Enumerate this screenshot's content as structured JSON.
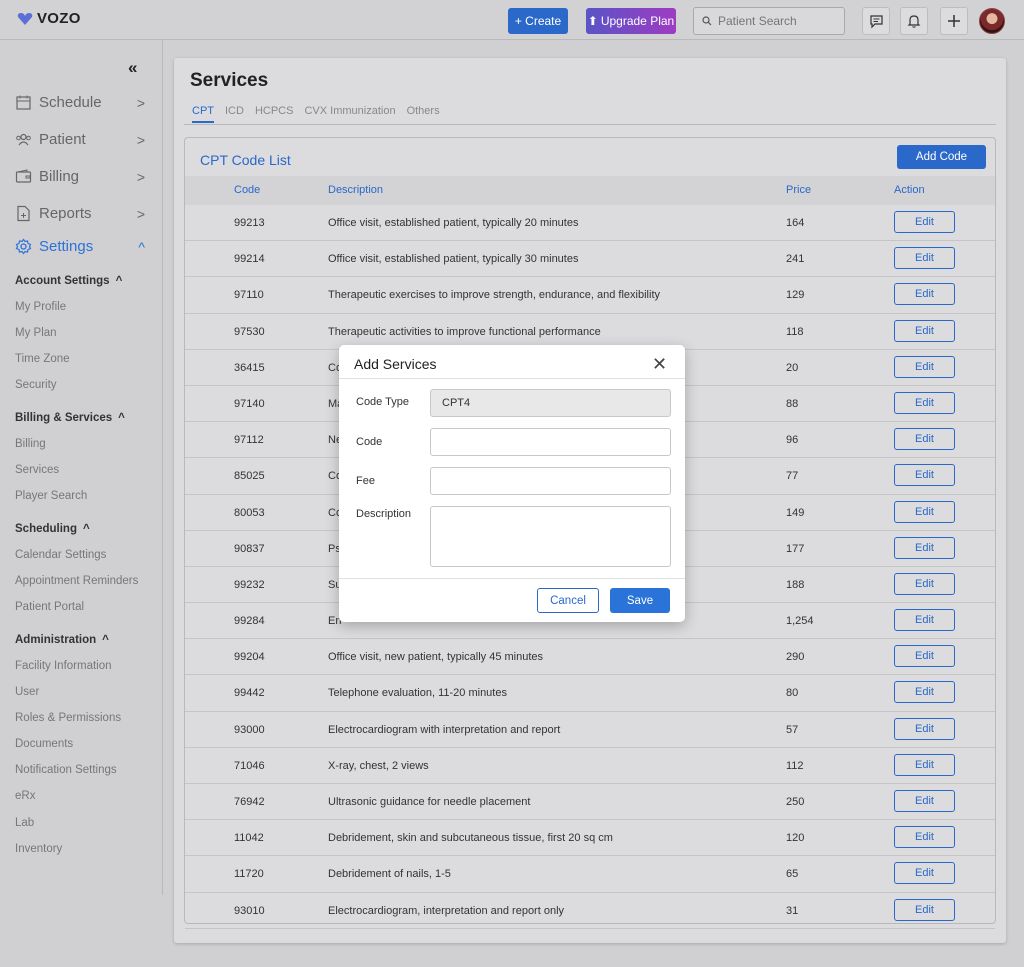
{
  "topbar": {
    "logo_text": "VOZO",
    "create_label": "+ Create",
    "upgrade_label": "Upgrade Plan",
    "search_placeholder": "Patient Search"
  },
  "sidebar": {
    "nav": [
      {
        "label": "Schedule"
      },
      {
        "label": "Patient"
      },
      {
        "label": "Billing"
      },
      {
        "label": "Reports"
      },
      {
        "label": "Settings"
      }
    ],
    "sections": [
      {
        "title": "Account Settings",
        "items": [
          "My Profile",
          "My Plan",
          "Time Zone",
          "Security"
        ]
      },
      {
        "title": "Billing & Services",
        "items": [
          "Billing",
          "Services",
          "Player Search"
        ]
      },
      {
        "title": "Scheduling",
        "items": [
          "Calendar Settings",
          "Appointment Reminders",
          "Patient Portal"
        ]
      },
      {
        "title": "Administration",
        "items": [
          "Facility Information",
          "User",
          "Roles & Permissions",
          "Documents",
          "Notification Settings",
          "eRx",
          "Lab",
          "Inventory"
        ]
      }
    ]
  },
  "page": {
    "title": "Services",
    "tabs": [
      "CPT",
      "ICD",
      "HCPCS",
      "CVX Immunization",
      "Others"
    ]
  },
  "table": {
    "title": "CPT Code List",
    "add_label": "Add Code",
    "headers": {
      "code": "Code",
      "description": "Description",
      "price": "Price",
      "action": "Action"
    },
    "edit_label": "Edit",
    "rows": [
      {
        "code": "99213",
        "description": "Office visit, established patient, typically 20 minutes",
        "price": "164"
      },
      {
        "code": "99214",
        "description": "Office visit, established patient, typically 30 minutes",
        "price": "241"
      },
      {
        "code": "97110",
        "description": "Therapeutic exercises to improve strength, endurance, and flexibility",
        "price": "129"
      },
      {
        "code": "97530",
        "description": "Therapeutic activities to improve functional performance",
        "price": "118"
      },
      {
        "code": "36415",
        "description": "Co",
        "price": "20"
      },
      {
        "code": "97140",
        "description": "Ma",
        "price": "88"
      },
      {
        "code": "97112",
        "description": "Ne",
        "price": "96"
      },
      {
        "code": "85025",
        "description": "Co",
        "price": "77"
      },
      {
        "code": "80053",
        "description": "Co",
        "price": "149"
      },
      {
        "code": "90837",
        "description": "Ps",
        "price": "177"
      },
      {
        "code": "99232",
        "description": "Su",
        "price": "188"
      },
      {
        "code": "99284",
        "description": "En",
        "price": "1,254"
      },
      {
        "code": "99204",
        "description": "Office visit, new patient, typically 45 minutes",
        "price": "290"
      },
      {
        "code": "99442",
        "description": "Telephone evaluation, 11-20 minutes",
        "price": "80"
      },
      {
        "code": "93000",
        "description": "Electrocardiogram with interpretation and report",
        "price": "57"
      },
      {
        "code": "71046",
        "description": "X-ray, chest, 2 views",
        "price": "112"
      },
      {
        "code": "76942",
        "description": "Ultrasonic guidance for needle placement",
        "price": "250"
      },
      {
        "code": "11042",
        "description": "Debridement, skin and subcutaneous tissue, first 20 sq cm",
        "price": "120"
      },
      {
        "code": "11720",
        "description": "Debridement of nails, 1-5",
        "price": "65"
      },
      {
        "code": "93010",
        "description": "Electrocardiogram, interpretation and report only",
        "price": "31"
      }
    ]
  },
  "modal": {
    "title": "Add Services",
    "code_type_label": "Code Type",
    "code_type_value": "CPT4",
    "code_label": "Code",
    "code_value": "",
    "fee_label": "Fee",
    "fee_value": "",
    "description_label": "Description",
    "description_value": "",
    "cancel_label": "Cancel",
    "save_label": "Save"
  },
  "colors": {
    "accent": "#2a68c9",
    "upgrade_start": "#5a53c6",
    "upgrade_end": "#9e3cc2"
  }
}
